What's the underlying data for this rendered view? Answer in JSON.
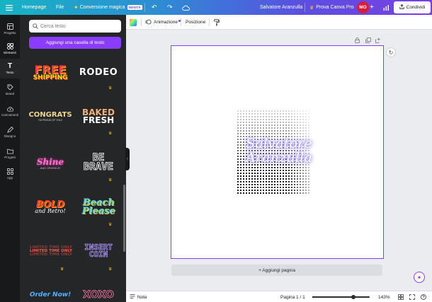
{
  "topbar": {
    "home": "Homepage",
    "file": "File",
    "magic": "Conversione magica",
    "magic_badge": "NOVITÀ",
    "doc_title": "Salvatore Aranzulla",
    "pro": "Prova Canva Pro",
    "avatar": "MO",
    "share": "Condividi"
  },
  "rail": [
    {
      "label": "Progetto",
      "icon": "layout-icon"
    },
    {
      "label": "Elementi",
      "icon": "shapes-icon"
    },
    {
      "label": "Testo",
      "icon": "text-icon"
    },
    {
      "label": "Brand",
      "icon": "brand-icon"
    },
    {
      "label": "Caricamenti",
      "icon": "upload-icon"
    },
    {
      "label": "Disegno",
      "icon": "draw-icon"
    },
    {
      "label": "Progetti",
      "icon": "folder-icon"
    },
    {
      "label": "App",
      "icon": "apps-icon"
    }
  ],
  "panel": {
    "search_placeholder": "Cerca testo",
    "add_text": "Aggiungi una casella di testo",
    "tiles": [
      {
        "l1": "FREE",
        "l2": "SHIPPING"
      },
      {
        "l1": "RODEO"
      },
      {
        "l1": "CONGRATS",
        "l2": "I'M PROUD OF YOU!"
      },
      {
        "l1": "BAKED",
        "l2": "FRESH"
      },
      {
        "l1": "Shine",
        "l2": "AND SPARKLE!"
      },
      {
        "l1": "BE",
        "l2": "BRAVE"
      },
      {
        "l1": "BOLD",
        "l2": "and Retro!"
      },
      {
        "l1": "Beach",
        "l2": "Please"
      },
      {
        "l1": "LIMITED TIME ONLY"
      },
      {
        "l1": "INSERT",
        "l2": "COIN"
      },
      {
        "l1": "Order Now!"
      },
      {
        "l1": "XOXO"
      }
    ]
  },
  "toolbar": {
    "animation": "Animazione",
    "position": "Posizione"
  },
  "canvas": {
    "line1": "Salvatore",
    "line2": "Aranzulla",
    "add_page": "+ Aggiungi pagina"
  },
  "bottombar": {
    "notes": "Note",
    "page": "Pagina 1 / 1",
    "zoom": "143%",
    "zoom_fraction": 0.72
  },
  "colors": {
    "accent": "#8b3dff",
    "avatar": "#d71d3b",
    "crown": "#f5b800"
  }
}
